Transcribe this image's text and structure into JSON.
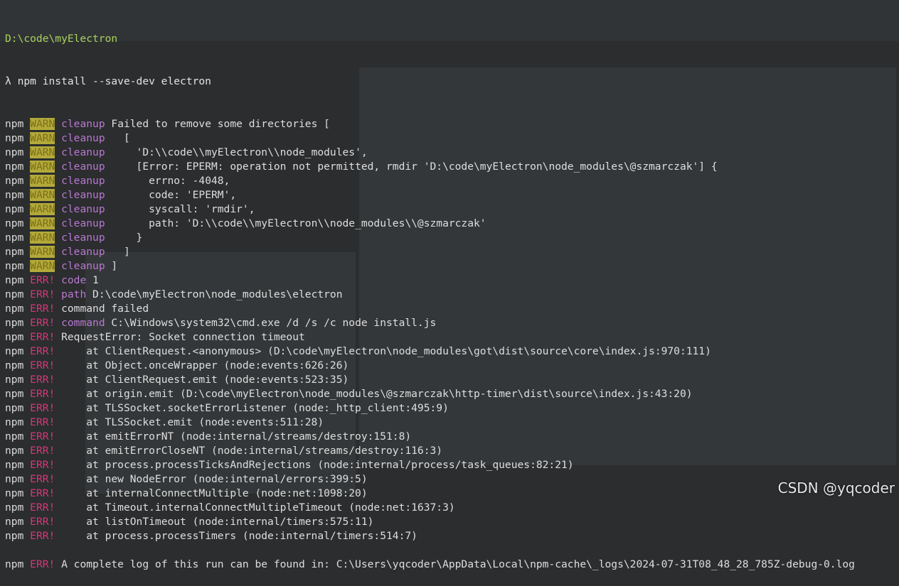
{
  "terminal": {
    "cwd": "D:\\code\\myElectron",
    "prompt": "λ",
    "command": "npm install --save-dev electron",
    "lines": [
      {
        "p": "npm",
        "lv": "WARN",
        "cls": "warn",
        "kw": "cleanup",
        "msg": " Failed to remove some directories ["
      },
      {
        "p": "npm",
        "lv": "WARN",
        "cls": "warn",
        "kw": "cleanup",
        "msg": "   ["
      },
      {
        "p": "npm",
        "lv": "WARN",
        "cls": "warn",
        "kw": "cleanup",
        "msg": "     'D:\\\\code\\\\myElectron\\\\node_modules',"
      },
      {
        "p": "npm",
        "lv": "WARN",
        "cls": "warn",
        "kw": "cleanup",
        "msg": "     [Error: EPERM: operation not permitted, rmdir 'D:\\code\\myElectron\\node_modules\\@szmarczak'] {"
      },
      {
        "p": "npm",
        "lv": "WARN",
        "cls": "warn",
        "kw": "cleanup",
        "msg": "       errno: -4048,"
      },
      {
        "p": "npm",
        "lv": "WARN",
        "cls": "warn",
        "kw": "cleanup",
        "msg": "       code: 'EPERM',"
      },
      {
        "p": "npm",
        "lv": "WARN",
        "cls": "warn",
        "kw": "cleanup",
        "msg": "       syscall: 'rmdir',"
      },
      {
        "p": "npm",
        "lv": "WARN",
        "cls": "warn",
        "kw": "cleanup",
        "msg": "       path: 'D:\\\\code\\\\myElectron\\\\node_modules\\\\@szmarczak'"
      },
      {
        "p": "npm",
        "lv": "WARN",
        "cls": "warn",
        "kw": "cleanup",
        "msg": "     }"
      },
      {
        "p": "npm",
        "lv": "WARN",
        "cls": "warn",
        "kw": "cleanup",
        "msg": "   ]"
      },
      {
        "p": "npm",
        "lv": "WARN",
        "cls": "warn",
        "kw": "cleanup",
        "msg": " ]"
      },
      {
        "p": "npm",
        "lv": "ERR!",
        "cls": "err",
        "kw": "code",
        "msg": " 1"
      },
      {
        "p": "npm",
        "lv": "ERR!",
        "cls": "err",
        "kw": "path",
        "msg": " D:\\code\\myElectron\\node_modules\\electron"
      },
      {
        "p": "npm",
        "lv": "ERR!",
        "cls": "err",
        "kw": "",
        "msg": "command failed"
      },
      {
        "p": "npm",
        "lv": "ERR!",
        "cls": "err",
        "kw": "command",
        "msg": " C:\\Windows\\system32\\cmd.exe /d /s /c node install.js"
      },
      {
        "p": "npm",
        "lv": "ERR!",
        "cls": "err",
        "kw": "",
        "msg": "RequestError: Socket connection timeout"
      },
      {
        "p": "npm",
        "lv": "ERR!",
        "cls": "err",
        "kw": "",
        "msg": "    at ClientRequest.<anonymous> (D:\\code\\myElectron\\node_modules\\got\\dist\\source\\core\\index.js:970:111)"
      },
      {
        "p": "npm",
        "lv": "ERR!",
        "cls": "err",
        "kw": "",
        "msg": "    at Object.onceWrapper (node:events:626:26)"
      },
      {
        "p": "npm",
        "lv": "ERR!",
        "cls": "err",
        "kw": "",
        "msg": "    at ClientRequest.emit (node:events:523:35)"
      },
      {
        "p": "npm",
        "lv": "ERR!",
        "cls": "err",
        "kw": "",
        "msg": "    at origin.emit (D:\\code\\myElectron\\node_modules\\@szmarczak\\http-timer\\dist\\source\\index.js:43:20)"
      },
      {
        "p": "npm",
        "lv": "ERR!",
        "cls": "err",
        "kw": "",
        "msg": "    at TLSSocket.socketErrorListener (node:_http_client:495:9)"
      },
      {
        "p": "npm",
        "lv": "ERR!",
        "cls": "err",
        "kw": "",
        "msg": "    at TLSSocket.emit (node:events:511:28)"
      },
      {
        "p": "npm",
        "lv": "ERR!",
        "cls": "err",
        "kw": "",
        "msg": "    at emitErrorNT (node:internal/streams/destroy:151:8)"
      },
      {
        "p": "npm",
        "lv": "ERR!",
        "cls": "err",
        "kw": "",
        "msg": "    at emitErrorCloseNT (node:internal/streams/destroy:116:3)"
      },
      {
        "p": "npm",
        "lv": "ERR!",
        "cls": "err",
        "kw": "",
        "msg": "    at process.processTicksAndRejections (node:internal/process/task_queues:82:21)"
      },
      {
        "p": "npm",
        "lv": "ERR!",
        "cls": "err",
        "kw": "",
        "msg": "    at new NodeError (node:internal/errors:399:5)"
      },
      {
        "p": "npm",
        "lv": "ERR!",
        "cls": "err",
        "kw": "",
        "msg": "    at internalConnectMultiple (node:net:1098:20)"
      },
      {
        "p": "npm",
        "lv": "ERR!",
        "cls": "err",
        "kw": "",
        "msg": "    at Timeout.internalConnectMultipleTimeout (node:net:1637:3)"
      },
      {
        "p": "npm",
        "lv": "ERR!",
        "cls": "err",
        "kw": "",
        "msg": "    at listOnTimeout (node:internal/timers:575:11)"
      },
      {
        "p": "npm",
        "lv": "ERR!",
        "cls": "err",
        "kw": "",
        "msg": "    at process.processTimers (node:internal/timers:514:7)"
      },
      {
        "blank": true
      },
      {
        "p": "npm",
        "lv": "ERR!",
        "cls": "err",
        "kw": "",
        "msg": "A complete log of this run can be found in: C:\\Users\\yqcoder\\AppData\\Local\\npm-cache\\_logs\\2024-07-31T08_48_28_785Z-debug-0.log"
      }
    ]
  },
  "watermark": "CSDN @yqcoder",
  "colors": {
    "background": "#2b2d2e",
    "path": "#a8d15c",
    "warn_bg": "#b3a93a",
    "err": "#d7377a",
    "keyword": "#b878d2"
  }
}
